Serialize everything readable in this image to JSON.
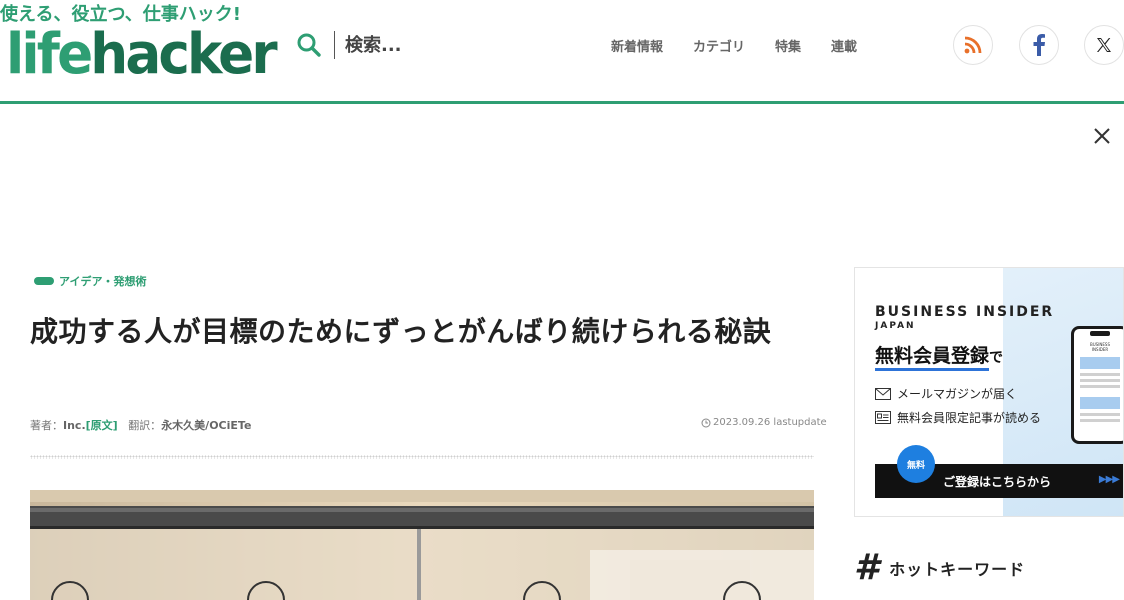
{
  "header": {
    "tagline": "使える、役立つ、仕事ハック!",
    "logo_light": "life",
    "logo_dark": "hacker",
    "search_placeholder": "検索...",
    "nav": [
      "新着情報",
      "カテゴリ",
      "特集",
      "連載"
    ],
    "social": [
      "rss-icon",
      "facebook-icon",
      "x-icon"
    ]
  },
  "article": {
    "category": "アイデア・発想術",
    "title": "成功する人が目標のためにずっとがんばり続けられる秘訣",
    "byline": {
      "author_label": "著者：",
      "author": "Inc.",
      "source_link": "[原文]",
      "translator_label": "翻訳：",
      "translator": "永木久美/OCiETe"
    },
    "date": "2023.09.26 lastupdate"
  },
  "ad": {
    "brand": "BUSINESS INSIDER",
    "brand_sub": "JAPAN",
    "headline": "無料会員登録",
    "headline_suffix": "で",
    "features": [
      "メールマガジンが届く",
      "無料会員限定記事が読める"
    ],
    "badge": "無料",
    "cta": "ご登録はこちらから",
    "phone_brand": "BUSINESS INSIDER"
  },
  "sidebar": {
    "hot_keywords_label": "ホットキーワード"
  },
  "colors": {
    "brand_green": "#2e9e73",
    "ad_blue": "#1e7fe0"
  }
}
